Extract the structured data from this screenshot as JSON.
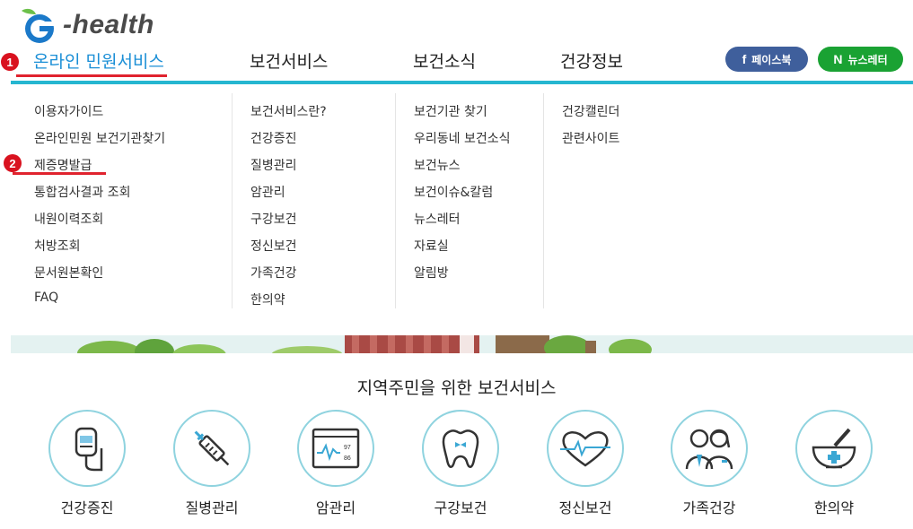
{
  "logo": {
    "text": "-health"
  },
  "gnb": {
    "items": [
      {
        "label": "온라인 민원서비스"
      },
      {
        "label": "보건서비스"
      },
      {
        "label": "보건소식"
      },
      {
        "label": "건강정보"
      }
    ]
  },
  "social": {
    "facebook": "페이스북",
    "newsletter": "뉴스레터",
    "facebook_icon": "f",
    "newsletter_icon": "N"
  },
  "markers": {
    "one": "1",
    "two": "2"
  },
  "dropdown": {
    "col1": [
      "이용자가이드",
      "온라인민원 보건기관찾기",
      "제증명발급",
      "통합검사결과 조회",
      "내원이력조회",
      "처방조회",
      "문서원본확인",
      "FAQ"
    ],
    "col2": [
      "보건서비스란?",
      "건강증진",
      "질병관리",
      "암관리",
      "구강보건",
      "정신보건",
      "가족건강",
      "한의약"
    ],
    "col3": [
      "보건기관 찾기",
      "우리동네 보건소식",
      "보건뉴스",
      "보건이슈&칼럼",
      "뉴스레터",
      "자료실",
      "알림방"
    ],
    "col4": [
      "건강캘린더",
      "관련사이트"
    ]
  },
  "services": {
    "title": "지역주민을 위한 보건서비스",
    "items": [
      {
        "label": "건강증진",
        "icon": "iv-drip-icon"
      },
      {
        "label": "질병관리",
        "icon": "syringe-icon"
      },
      {
        "label": "암관리",
        "icon": "monitor-chart-icon"
      },
      {
        "label": "구강보건",
        "icon": "tooth-icon"
      },
      {
        "label": "정신보건",
        "icon": "heart-pulse-icon"
      },
      {
        "label": "가족건강",
        "icon": "family-icon"
      },
      {
        "label": "한의약",
        "icon": "mortar-pestle-icon"
      }
    ],
    "monitor_values": [
      "97",
      "86"
    ]
  },
  "colors": {
    "accent": "#1b8fd6",
    "bar": "#26b6d0",
    "marker": "#d9121f",
    "facebook": "#3f5f9c",
    "newsletter": "#1aa233"
  }
}
